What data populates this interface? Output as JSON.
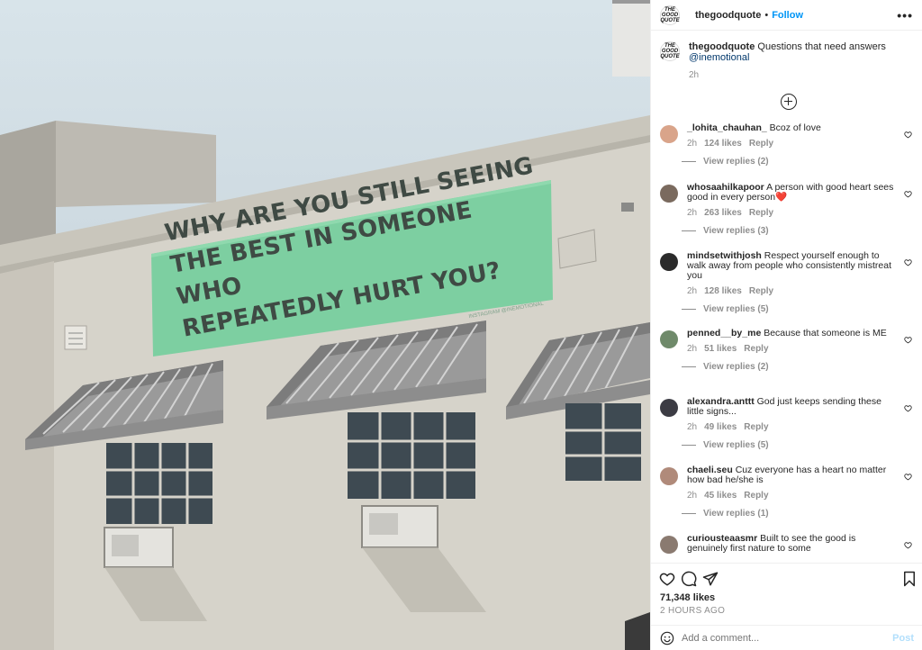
{
  "post": {
    "username": "thegoodquote",
    "follow_label": "Follow",
    "more_label": "•••",
    "avatar_logo_text": "THE GOOD QUOTE",
    "caption_text": "Questions that need answers",
    "caption_mention": "@inemotional",
    "caption_time": "2h",
    "image_text": "WHY ARE YOU STILL SEEING\nTHE BEST IN SOMEONE WHO\nREPEATEDLY HURT YOU?",
    "image_watermark": "INSTAGRAM @INEMOTIONAL",
    "likes": "71,348 likes",
    "posted_ago": "2 HOURS AGO"
  },
  "comments": [
    {
      "user": "_lohita_chauhan_",
      "text": "Bcoz of love",
      "time": "2h",
      "likes": "124 likes",
      "reply": "Reply",
      "view_replies": "View replies (2)",
      "avatar_color": "#d9a48a"
    },
    {
      "user": "whosaahilkapoor",
      "text": "A person with good heart sees good in every person❤️",
      "time": "2h",
      "likes": "263 likes",
      "reply": "Reply",
      "view_replies": "View replies (3)",
      "avatar_color": "#7a6a5e"
    },
    {
      "user": "mindsetwithjosh",
      "text": "Respect yourself enough to walk away from people who consistently mistreat you",
      "time": "2h",
      "likes": "128 likes",
      "reply": "Reply",
      "view_replies": "View replies (5)",
      "avatar_color": "#2b2b2b"
    },
    {
      "user": "penned__by_me",
      "text": "Because that someone is ME",
      "time": "2h",
      "likes": "51 likes",
      "reply": "Reply",
      "view_replies": "View replies (2)",
      "avatar_color": "#6f8a6a"
    },
    {
      "user": "alexandra.anttt",
      "text": "God just keeps sending these little signs...",
      "time": "2h",
      "likes": "49 likes",
      "reply": "Reply",
      "view_replies": "View replies (5)",
      "avatar_color": "#3c3c44"
    },
    {
      "user": "chaeli.seu",
      "text": "Cuz everyone has a heart no matter how bad he/she is",
      "time": "2h",
      "likes": "45 likes",
      "reply": "Reply",
      "view_replies": "View replies (1)",
      "avatar_color": "#b08a7a"
    },
    {
      "user": "curiousteaasmr",
      "text": "Built to see the good is genuinely first nature to some",
      "avatar_color": "#8a7a70"
    }
  ],
  "add_comment": {
    "placeholder": "Add a comment...",
    "post_label": "Post"
  },
  "icons": [
    "heart-icon",
    "comment-icon",
    "share-icon",
    "bookmark-icon",
    "emoji-icon",
    "add-circle-icon",
    "more-icon"
  ]
}
